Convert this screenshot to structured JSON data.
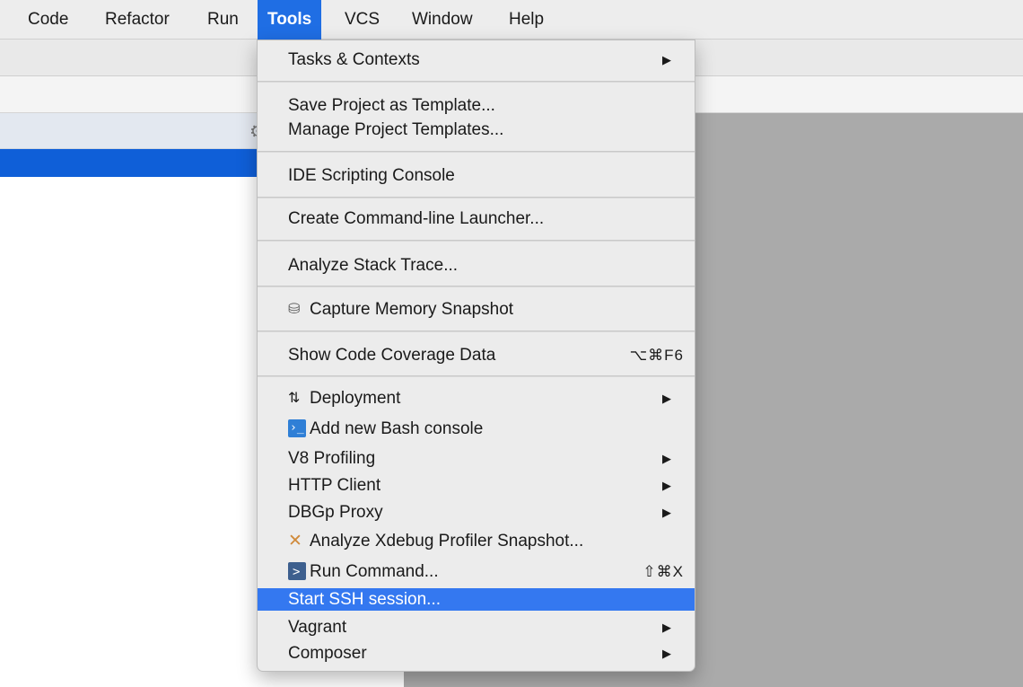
{
  "menubar": {
    "items": [
      {
        "label": "Code"
      },
      {
        "label": "Refactor"
      },
      {
        "label": "Run"
      },
      {
        "label": "Tools"
      },
      {
        "label": "VCS"
      },
      {
        "label": "Window"
      },
      {
        "label": "Help"
      }
    ],
    "active": "Tools"
  },
  "tools_menu": {
    "tasks_contexts": "Tasks & Contexts",
    "save_template": "Save Project as Template...",
    "manage_templates": "Manage Project Templates...",
    "scripting_console": "IDE Scripting Console",
    "cmd_launcher": "Create Command-line Launcher...",
    "analyze_stack": "Analyze Stack Trace...",
    "capture_memory": "Capture Memory Snapshot",
    "code_coverage": "Show Code Coverage Data",
    "code_coverage_shortcut": "⌥⌘F6",
    "deployment": "Deployment",
    "bash_console": "Add new Bash console",
    "v8_profiling": "V8 Profiling",
    "http_client": "HTTP Client",
    "dbgp_proxy": "DBGp Proxy",
    "xdebug_snapshot": "Analyze Xdebug Profiler Snapshot...",
    "run_command": "Run Command...",
    "run_command_shortcut": "⇧⌘X",
    "ssh_session": "Start SSH session...",
    "vagrant": "Vagrant",
    "composer": "Composer",
    "submenu_arrow": "▶"
  },
  "icons": {
    "memory": "memory-snapshot-icon",
    "deployment": "deployment-icon",
    "bash": "bash-console-icon",
    "xdebug": "xdebug-icon",
    "run": "run-command-icon"
  },
  "colors": {
    "menu_highlight": "#3478f0",
    "active_menubar": "#1f6ee4",
    "selection": "#0f5fd8",
    "editor_bg": "#aaaaaa"
  }
}
